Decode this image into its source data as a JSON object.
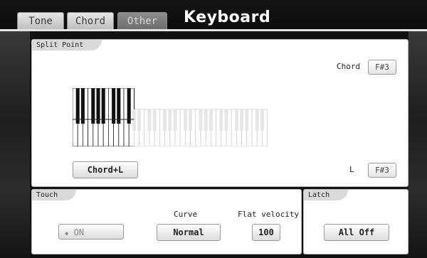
{
  "header": {
    "tabs": [
      {
        "label": "Tone",
        "active": false
      },
      {
        "label": "Chord",
        "active": false
      },
      {
        "label": "Other",
        "active": true
      }
    ],
    "title": "Keyboard"
  },
  "split_point": {
    "label": "Split Point",
    "chord_label": "Chord",
    "chord_value": "F#3",
    "l_label": "L",
    "l_value": "F#3",
    "mode_button": "Chord+L"
  },
  "touch": {
    "label": "Touch",
    "on_button": "ON",
    "curve_label": "Curve",
    "curve_value": "Normal",
    "flat_velocity_label": "Flat velocity",
    "flat_velocity_value": "100"
  },
  "latch": {
    "label": "Latch",
    "button": "All Off"
  },
  "colors": {
    "panel_bg": "#ffffff",
    "header_bg": "#0b0b0b",
    "active_tab": "#7a7a7a",
    "inactive_tab": "#d0d0d0"
  }
}
